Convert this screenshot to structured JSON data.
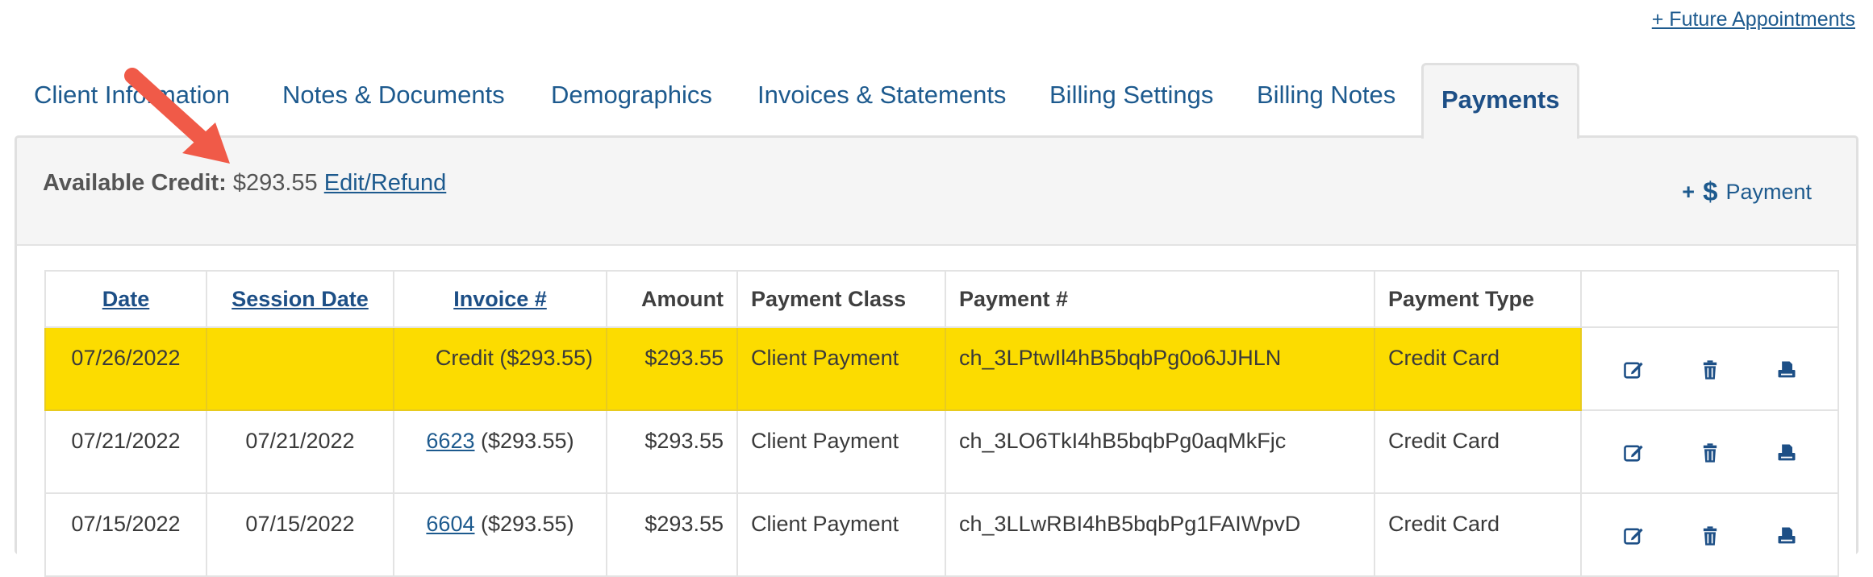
{
  "header": {
    "future_link": "+  Future Appointments"
  },
  "tabs": [
    {
      "label": "Client Information"
    },
    {
      "label": "Notes & Documents"
    },
    {
      "label": "Demographics"
    },
    {
      "label": "Invoices & Statements"
    },
    {
      "label": "Billing Settings"
    },
    {
      "label": "Billing Notes"
    },
    {
      "label": "Payments"
    }
  ],
  "credit": {
    "label": "Available Credit:",
    "amount": "$293.55",
    "edit_link": "Edit/Refund"
  },
  "payment_button": {
    "plus": "+",
    "dollar": "$",
    "label": "Payment"
  },
  "table": {
    "headers": [
      "Date",
      "Session Date",
      "Invoice #",
      "Amount",
      "Payment Class",
      "Payment #",
      "Payment Type"
    ],
    "rows": [
      {
        "date": "07/26/2022",
        "session_date": "",
        "invoice_link": "",
        "invoice_text": "Credit ($293.55)",
        "amount": "$293.55",
        "payment_class": "Client Payment",
        "payment_no": "ch_3LPtwIl4hB5bqbPg0o6JJHLN",
        "payment_type": "Credit Card"
      },
      {
        "date": "07/21/2022",
        "session_date": "07/21/2022",
        "invoice_link": "6623",
        "invoice_text": " ($293.55)",
        "amount": "$293.55",
        "payment_class": "Client Payment",
        "payment_no": "ch_3LO6TkI4hB5bqbPg0aqMkFjc",
        "payment_type": "Credit Card"
      },
      {
        "date": "07/15/2022",
        "session_date": "07/15/2022",
        "invoice_link": "6604",
        "invoice_text": " ($293.55)",
        "amount": "$293.55",
        "payment_class": "Client Payment",
        "payment_no": "ch_3LLwRBI4hB5bqbPg1FAIWpvD",
        "payment_type": "Credit Card"
      }
    ]
  },
  "colors": {
    "link": "#1d5a8e",
    "highlight": "#fcdc00",
    "arrow": "#f05a48"
  }
}
